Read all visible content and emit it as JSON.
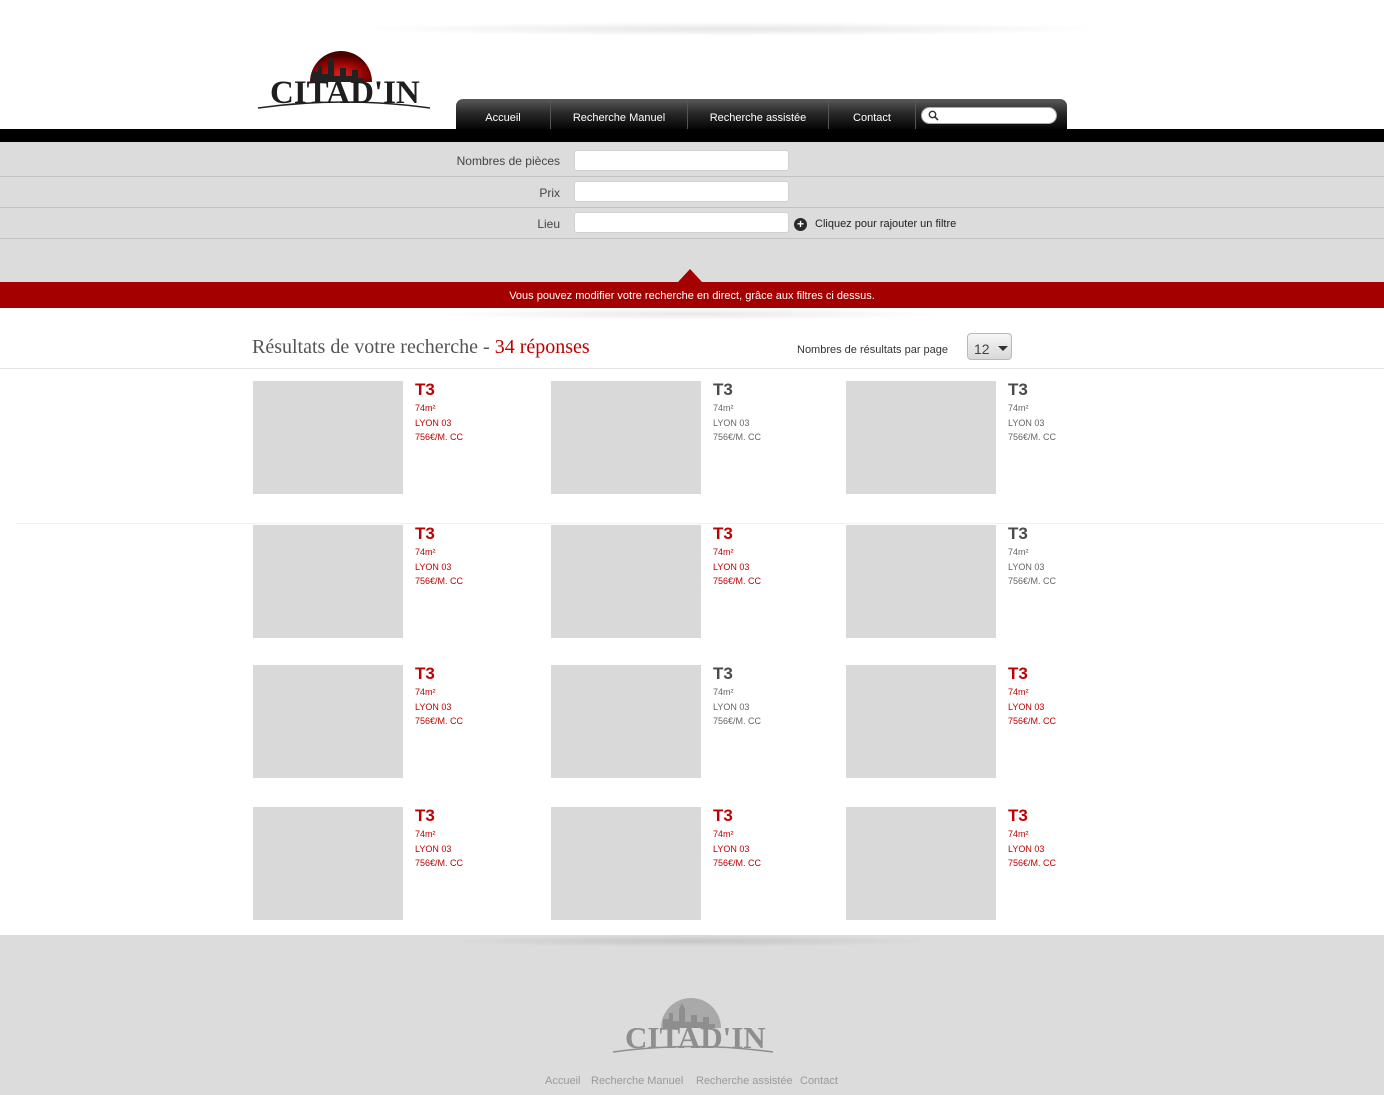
{
  "logo": {
    "text": "CITAD'IN"
  },
  "nav": {
    "items": [
      "Accueil",
      "Recherche Manuel",
      "Recherche assistée",
      "Contact"
    ],
    "search_value": ""
  },
  "filters": {
    "rows": [
      {
        "label": "Nombres de pièces",
        "value": ""
      },
      {
        "label": "Prix",
        "value": ""
      },
      {
        "label": "Lieu",
        "value": ""
      }
    ],
    "add_filter_label": "Cliquez pour rajouter un filtre"
  },
  "banner": {
    "text": "Vous pouvez modifier votre recherche en direct, grâce aux filtres ci dessus."
  },
  "results": {
    "title": "Résultats de votre recherche",
    "separator": " - ",
    "count_text": "34 réponses",
    "per_page_label": "Nombres de résultats par page",
    "per_page_value": "12"
  },
  "listings": [
    {
      "title": "T3",
      "area": "74m²",
      "location": "LYON 03",
      "price": "756€/M. CC",
      "highlighted": true
    },
    {
      "title": "T3",
      "area": "74m²",
      "location": "LYON 03",
      "price": "756€/M. CC",
      "highlighted": false
    },
    {
      "title": "T3",
      "area": "74m²",
      "location": "LYON 03",
      "price": "756€/M. CC",
      "highlighted": false
    },
    {
      "title": "T3",
      "area": "74m²",
      "location": "LYON 03",
      "price": "756€/M. CC",
      "highlighted": true
    },
    {
      "title": "T3",
      "area": "74m²",
      "location": "LYON 03",
      "price": "756€/M. CC",
      "highlighted": true
    },
    {
      "title": "T3",
      "area": "74m²",
      "location": "LYON 03",
      "price": "756€/M. CC",
      "highlighted": false
    },
    {
      "title": "T3",
      "area": "74m²",
      "location": "LYON 03",
      "price": "756€/M. CC",
      "highlighted": true
    },
    {
      "title": "T3",
      "area": "74m²",
      "location": "LYON 03",
      "price": "756€/M. CC",
      "highlighted": false
    },
    {
      "title": "T3",
      "area": "74m²",
      "location": "LYON 03",
      "price": "756€/M. CC",
      "highlighted": true
    },
    {
      "title": "T3",
      "area": "74m²",
      "location": "LYON 03",
      "price": "756€/M. CC",
      "highlighted": true
    },
    {
      "title": "T3",
      "area": "74m²",
      "location": "LYON 03",
      "price": "756€/M. CC",
      "highlighted": true
    },
    {
      "title": "T3",
      "area": "74m²",
      "location": "LYON 03",
      "price": "756€/M. CC",
      "highlighted": true
    }
  ],
  "footer": {
    "links": [
      "Accueil",
      "Recherche Manuel",
      "Recherche assistée",
      "Contact"
    ]
  },
  "colors": {
    "accent": "#c00000",
    "banner": "#a50000",
    "panel": "#dcdcdc"
  }
}
